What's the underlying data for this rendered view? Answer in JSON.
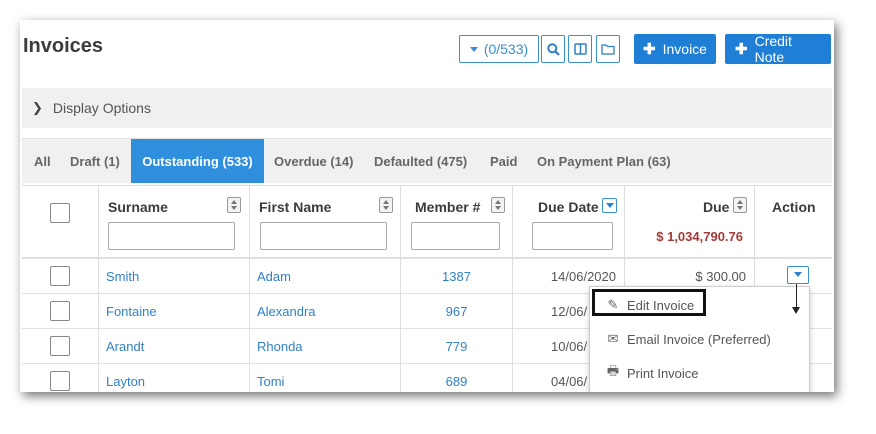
{
  "page": {
    "title": "Invoices"
  },
  "toolbar": {
    "filter_count": "(0/533)",
    "invoice_label": "Invoice",
    "credit_note_label": "Credit Note"
  },
  "display_options": {
    "label": "Display Options"
  },
  "tabs": [
    {
      "label": "All"
    },
    {
      "label": "Draft (1)"
    },
    {
      "label": "Outstanding (533)",
      "active": true
    },
    {
      "label": "Overdue (14)"
    },
    {
      "label": "Defaulted (475)"
    },
    {
      "label": "Paid"
    },
    {
      "label": "On Payment Plan (63)"
    }
  ],
  "columns": {
    "surname": "Surname",
    "first_name": "First Name",
    "member": "Member #",
    "due_date": "Due Date",
    "due": "Due",
    "action": "Action"
  },
  "totals": {
    "due": "$ 1,034,790.76"
  },
  "rows": [
    {
      "surname": "Smith",
      "first_name": "Adam",
      "member": "1387",
      "due_date": "14/06/2020",
      "due": "$ 300.00"
    },
    {
      "surname": "Fontaine",
      "first_name": "Alexandra",
      "member": "967",
      "due_date": "12/06/",
      "due": ""
    },
    {
      "surname": "Arandt",
      "first_name": "Rhonda",
      "member": "779",
      "due_date": "10/06/",
      "due": ""
    },
    {
      "surname": "Layton",
      "first_name": "Tomi",
      "member": "689",
      "due_date": "04/06/",
      "due": ""
    }
  ],
  "action_menu": {
    "items": [
      {
        "label": "Edit Invoice",
        "icon": "pencil-icon"
      },
      {
        "label": "Email Invoice (Preferred)",
        "icon": "envelope-icon"
      },
      {
        "label": "Print Invoice",
        "icon": "print-icon"
      }
    ]
  },
  "colors": {
    "accent": "#1f7fd6",
    "due_total": "#a33a3a",
    "link": "#3381c8"
  }
}
